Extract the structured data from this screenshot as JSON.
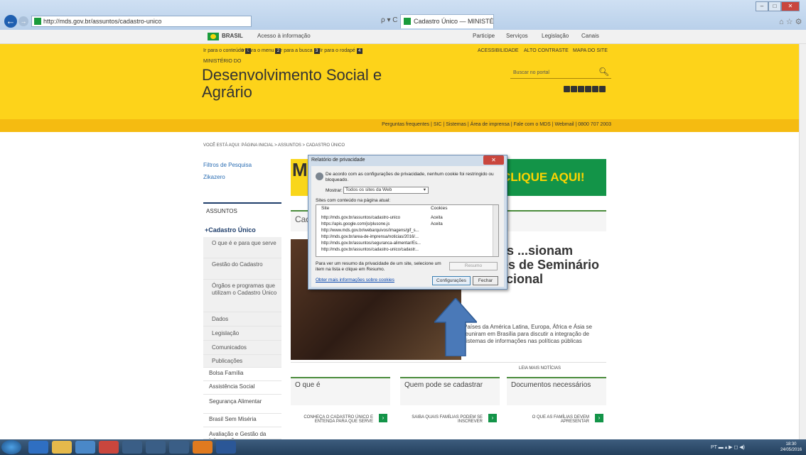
{
  "browser": {
    "url": "http://mds.gov.br/assuntos/cadastro-unico",
    "search_icons": "ρ ▾ C",
    "tab_title": "Cadastro Único — MINISTÉ...",
    "tab_close": "×",
    "window_buttons": [
      "–",
      "□",
      "✕"
    ],
    "tool_icons": "⌂ ☆ ⚙"
  },
  "govbar": {
    "brasil": "BRASIL",
    "acesso": "Acesso à informação",
    "links": [
      "Participe",
      "Serviços",
      "Legislação",
      "Canais"
    ]
  },
  "accessibility": {
    "skip": [
      {
        "label": "Ir para o conteúdo",
        "key": "1"
      },
      {
        "label": "Ir para o menu",
        "key": "2"
      },
      {
        "label": "Ir para a busca",
        "key": "3"
      },
      {
        "label": "Ir para o rodapé",
        "key": "4"
      }
    ],
    "links": [
      "ACESSIBILIDADE",
      "ALTO CONTRASTE",
      "MAPA DO SITE"
    ]
  },
  "header": {
    "ministry": "MINISTÉRIO DO",
    "title": "Desenvolvimento Social e Agrário",
    "search_placeholder": "Buscar no portal",
    "top_links": "Perguntas frequentes  |  SIC  |  Sistemas  |  Área de imprensa  |  Fale com o MDS  |  Webmail  |  0800 707 2003"
  },
  "breadcrumb": "VOCÊ ESTÁ AQUI:  PÁGINA INICIAL > ASSUNTOS > CADASTRO ÚNICO",
  "sidebar": {
    "filters": "Filtros de Pesquisa",
    "zika": "Zikazero",
    "assuntos": "ASSUNTOS",
    "cadastro": "+Cadastro Único",
    "sub": [
      "O que é e para que serve",
      "Gestão do Cadastro",
      "Órgãos e programas que utilizam o Cadastro Único",
      "Dados",
      "Legislação",
      "Comunicados",
      "Publicações"
    ],
    "main": [
      "Bolsa Família",
      "Assistência Social",
      "Segurança Alimentar",
      "Brasil Sem Miséria",
      "Avaliação e Gestão da Informação"
    ]
  },
  "content": {
    "banner_left": "M",
    "banner_cta": "CLIQUE AQUI!",
    "section_title": "Cad",
    "headline": "...ências ...sionam ...pantes de Seminário Internacional",
    "excerpt": "Países da América Latina, Europa, África e Ásia se reuniram em Brasília para discutir a integração de sistemas de informações nas políticas públicas",
    "read_more": "LEIA MAIS NOTÍCIAS",
    "cards": [
      {
        "title": "O que é",
        "link": "CONHEÇA O CADASTRO ÚNICO E ENTENDA PARA QUE SERVE"
      },
      {
        "title": "Quem pode se cadastrar",
        "link": "SAIBA QUAIS FAMÍLIAS PODEM SE INSCREVER"
      },
      {
        "title": "Documentos necessários",
        "link": "O QUE AS FAMÍLIAS DEVEM APRESENTAR"
      }
    ]
  },
  "dialog": {
    "title": "Relatório de privacidade",
    "message": "De acordo com as configurações de privacidade, nenhum cookie foi restringido ou bloqueado.",
    "show_label": "Mostrar:",
    "show_value": "Todos os sites da Web",
    "sites_label": "Sites com conteúdo na página atual:",
    "col_site": "Site",
    "col_cookies": "Cookies",
    "rows": [
      {
        "site": "http://mds.gov.br/assuntos/cadastro-unico",
        "cookies": "Aceita"
      },
      {
        "site": "https://apis.google.com/js/plusone.js",
        "cookies": "Aceita"
      },
      {
        "site": "http://www.mds.gov.br/webarquivos/imagens/gif_s...",
        "cookies": ""
      },
      {
        "site": "http://mds.gov.br/area-de-imprensa/noticias/2016/...",
        "cookies": ""
      },
      {
        "site": "http://mds.gov.br/assuntos/seguranca-alimentar/Es...",
        "cookies": ""
      },
      {
        "site": "http://mds.gov.br/assuntos/cadastro-unico/cadastr...",
        "cookies": ""
      }
    ],
    "summary_hint": "Para ver um resumo da privacidade de um site, selecione um item na lista e clique em Resumo.",
    "resumo": "Resumo",
    "more_info": "Obter mais informações sobre cookies",
    "config": "Configurações",
    "close": "Fechar"
  },
  "taskbar": {
    "tray": "PT  ▬  ▴  ▶  ◻  ◀)",
    "time": "18:30",
    "date": "24/05/2016"
  },
  "colors": {
    "yellow": "#fdd31a",
    "green": "#139448",
    "navy": "#1f3e6b"
  }
}
